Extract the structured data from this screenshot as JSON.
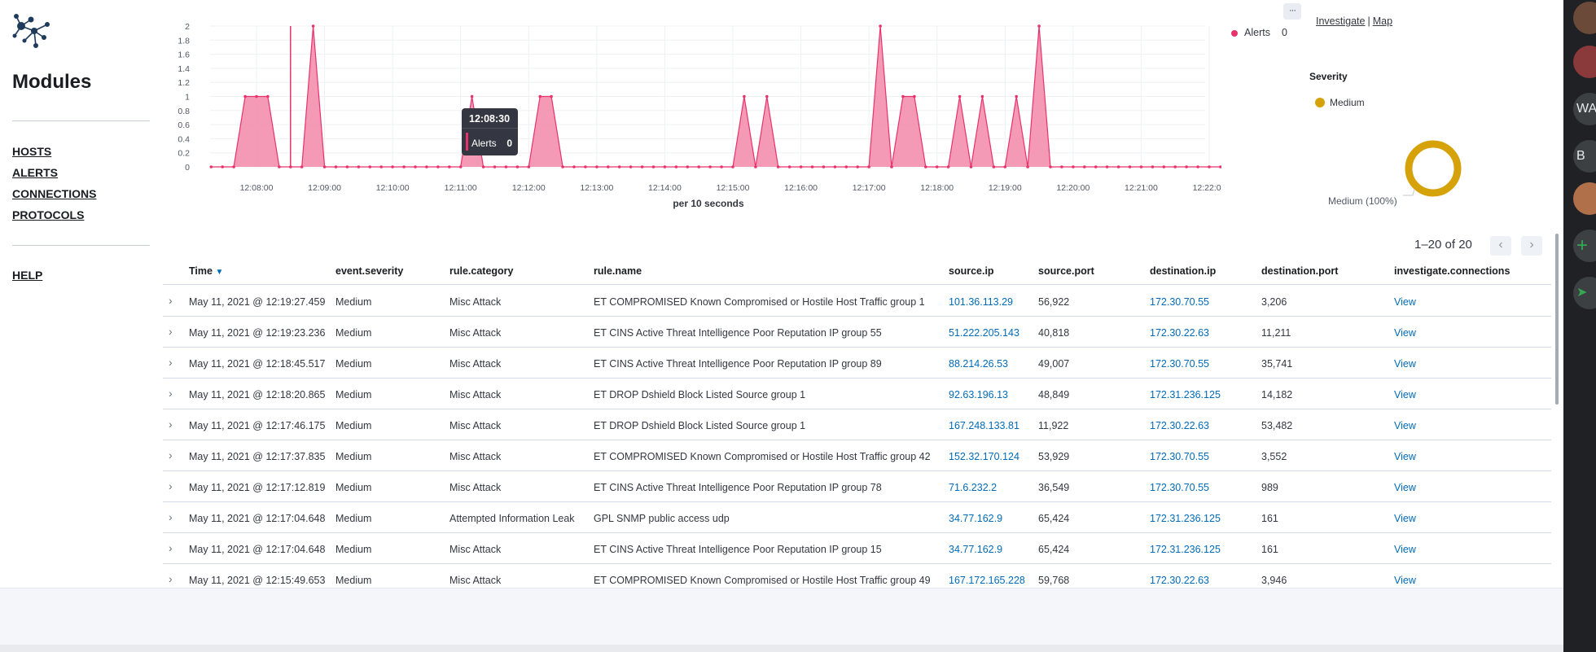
{
  "sidebar": {
    "title": "Modules",
    "nav": [
      "HOSTS",
      "ALERTS",
      "CONNECTIONS",
      "PROTOCOLS"
    ],
    "help": "HELP"
  },
  "chart_data": {
    "type": "area",
    "xlabel": "per 10 seconds",
    "y_ticks": [
      "0",
      "0.2",
      "0.4",
      "0.6",
      "0.8",
      "1",
      "1.2",
      "1.4",
      "1.6",
      "1.8",
      "2"
    ],
    "ylim": [
      0,
      2
    ],
    "x_ticks": [
      "12:08:00",
      "12:09:00",
      "12:10:00",
      "12:11:00",
      "12:12:00",
      "12:13:00",
      "12:14:00",
      "12:15:00",
      "12:16:00",
      "12:17:00",
      "12:18:00",
      "12:19:00",
      "12:20:00",
      "12:21:00",
      "12:22:00"
    ],
    "x_start": "12:07:20",
    "interval_seconds": 10,
    "series": [
      {
        "name": "Alerts",
        "color": "#e7336b",
        "values": [
          0,
          0,
          0,
          1,
          1,
          1,
          0,
          0,
          0,
          2,
          0,
          0,
          0,
          0,
          0,
          0,
          0,
          0,
          0,
          0,
          0,
          0,
          0,
          1,
          0,
          0,
          0,
          0,
          0,
          1,
          1,
          0,
          0,
          0,
          0,
          0,
          0,
          0,
          0,
          0,
          0,
          0,
          0,
          0,
          0,
          0,
          0,
          1,
          0,
          1,
          0,
          0,
          0,
          0,
          0,
          0,
          0,
          0,
          0,
          2,
          0,
          1,
          1,
          0,
          0,
          0,
          1,
          0,
          1,
          0,
          0,
          1,
          0,
          2,
          0,
          0,
          0,
          0,
          0,
          0,
          0,
          0,
          0,
          0,
          0,
          0,
          0,
          0,
          0,
          0,
          0
        ]
      }
    ],
    "grid": true,
    "cursor_time": "12:08:30",
    "tooltip": {
      "time": "12:08:30",
      "label": "Alerts",
      "value": "0"
    },
    "legend": {
      "label": "Alerts",
      "value": "0",
      "position": "top-right"
    }
  },
  "severity_chart": {
    "type": "pie",
    "title": "Severity",
    "legend": [
      {
        "label": "Medium",
        "color": "#d6a20a"
      }
    ],
    "slices": [
      {
        "label": "Medium",
        "value": 100
      }
    ],
    "slice_label": "Medium (100%)"
  },
  "actions": {
    "more": "···",
    "investigate": "Investigate",
    "separator": "|",
    "map": "Map"
  },
  "pagination": {
    "text": "1–20 of 20"
  },
  "table": {
    "columns": [
      "Time",
      "event.severity",
      "rule.category",
      "rule.name",
      "source.ip",
      "source.port",
      "destination.ip",
      "destination.port",
      "investigate.connections"
    ],
    "sort_column": "Time",
    "rows": [
      [
        "May 11, 2021 @ 12:19:27.459",
        "Medium",
        "Misc Attack",
        "ET COMPROMISED Known Compromised or Hostile Host Traffic group 1",
        "101.36.113.29",
        "56,922",
        "172.30.70.55",
        "3,206",
        "View"
      ],
      [
        "May 11, 2021 @ 12:19:23.236",
        "Medium",
        "Misc Attack",
        "ET CINS Active Threat Intelligence Poor Reputation IP group 55",
        "51.222.205.143",
        "40,818",
        "172.30.22.63",
        "11,211",
        "View"
      ],
      [
        "May 11, 2021 @ 12:18:45.517",
        "Medium",
        "Misc Attack",
        "ET CINS Active Threat Intelligence Poor Reputation IP group 89",
        "88.214.26.53",
        "49,007",
        "172.30.70.55",
        "35,741",
        "View"
      ],
      [
        "May 11, 2021 @ 12:18:20.865",
        "Medium",
        "Misc Attack",
        "ET DROP Dshield Block Listed Source group 1",
        "92.63.196.13",
        "48,849",
        "172.31.236.125",
        "14,182",
        "View"
      ],
      [
        "May 11, 2021 @ 12:17:46.175",
        "Medium",
        "Misc Attack",
        "ET DROP Dshield Block Listed Source group 1",
        "167.248.133.81",
        "11,922",
        "172.30.22.63",
        "53,482",
        "View"
      ],
      [
        "May 11, 2021 @ 12:17:37.835",
        "Medium",
        "Misc Attack",
        "ET COMPROMISED Known Compromised or Hostile Host Traffic group 42",
        "152.32.170.124",
        "53,929",
        "172.30.70.55",
        "3,552",
        "View"
      ],
      [
        "May 11, 2021 @ 12:17:12.819",
        "Medium",
        "Misc Attack",
        "ET CINS Active Threat Intelligence Poor Reputation IP group 78",
        "71.6.232.2",
        "36,549",
        "172.30.70.55",
        "989",
        "View"
      ],
      [
        "May 11, 2021 @ 12:17:04.648",
        "Medium",
        "Attempted Information Leak",
        "GPL SNMP public access udp",
        "34.77.162.9",
        "65,424",
        "172.31.236.125",
        "161",
        "View"
      ],
      [
        "May 11, 2021 @ 12:17:04.648",
        "Medium",
        "Misc Attack",
        "ET CINS Active Threat Intelligence Poor Reputation IP group 15",
        "34.77.162.9",
        "65,424",
        "172.31.236.125",
        "161",
        "View"
      ],
      [
        "May 11, 2021 @ 12:15:49.653",
        "Medium",
        "Misc Attack",
        "ET COMPROMISED Known Compromised or Hostile Host Traffic group 49",
        "167.172.165.228",
        "59,768",
        "172.30.22.63",
        "3,946",
        "View"
      ]
    ]
  },
  "right_rail": {
    "avatars": [
      "WA",
      "B"
    ]
  }
}
